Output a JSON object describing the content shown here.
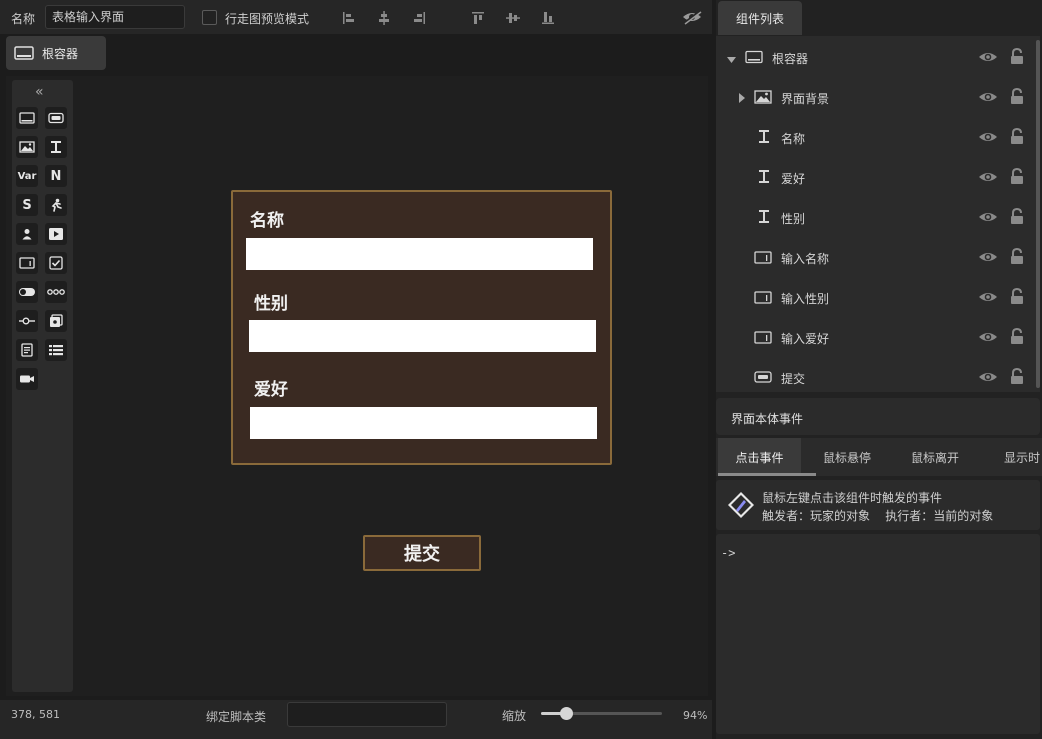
{
  "toolbar": {
    "name_label": "名称",
    "name_value": "表格输入界面",
    "preview_label": "行走图预览模式",
    "align_icons": [
      "align-left-icon",
      "align-center-h-icon",
      "align-right-icon",
      "align-top-icon",
      "align-center-v-icon",
      "align-bottom-icon"
    ],
    "preview_toggle_icon": "eye-slash-icon"
  },
  "root_tab": {
    "label": "根容器",
    "icon": "container-icon"
  },
  "palette": {
    "collapse_glyph": "«",
    "items": [
      {
        "name": "container-icon",
        "text": ""
      },
      {
        "name": "button-icon",
        "text": ""
      },
      {
        "name": "image-icon",
        "text": ""
      },
      {
        "name": "text-icon",
        "text": ""
      },
      {
        "name": "variable-icon",
        "text": "Var"
      },
      {
        "name": "number-icon",
        "text": "N"
      },
      {
        "name": "string-icon",
        "text": "S"
      },
      {
        "name": "actor-icon",
        "text": ""
      },
      {
        "name": "character-icon",
        "text": ""
      },
      {
        "name": "video-icon",
        "text": ""
      },
      {
        "name": "input-icon",
        "text": ""
      },
      {
        "name": "checkbox-icon",
        "text": ""
      },
      {
        "name": "switch-icon",
        "text": ""
      },
      {
        "name": "progress-icon",
        "text": ""
      },
      {
        "name": "slider-icon",
        "text": ""
      },
      {
        "name": "gallery-icon",
        "text": ""
      },
      {
        "name": "document-icon",
        "text": ""
      },
      {
        "name": "list-icon",
        "text": ""
      },
      {
        "name": "camera-icon",
        "text": ""
      }
    ]
  },
  "form": {
    "fields": [
      {
        "label": "名称",
        "value": ""
      },
      {
        "label": "性别",
        "value": ""
      },
      {
        "label": "爱好",
        "value": ""
      }
    ],
    "submit_label": "提交"
  },
  "statusbar": {
    "coords": "378, 581",
    "bind_label": "绑定脚本类",
    "bind_value": "",
    "zoom_label": "缩放",
    "zoom_value": "94%",
    "zoom_level": 0.94
  },
  "components": {
    "tab_label": "组件列表",
    "tree": [
      {
        "label": "根容器",
        "icon": "container-icon",
        "toggle": "caret-down-icon"
      },
      {
        "label": "界面背景",
        "icon": "image-icon",
        "toggle": "caret-right-icon"
      },
      {
        "label": "名称",
        "icon": "text-icon",
        "toggle": ""
      },
      {
        "label": "爱好",
        "icon": "text-icon",
        "toggle": ""
      },
      {
        "label": "性别",
        "icon": "text-icon",
        "toggle": ""
      },
      {
        "label": "输入名称",
        "icon": "input-icon",
        "toggle": ""
      },
      {
        "label": "输入性别",
        "icon": "input-icon",
        "toggle": ""
      },
      {
        "label": "输入爱好",
        "icon": "input-icon",
        "toggle": ""
      },
      {
        "label": "提交",
        "icon": "button-icon",
        "toggle": ""
      }
    ]
  },
  "events": {
    "title": "界面本体事件",
    "tabs": [
      "点击事件",
      "鼠标悬停",
      "鼠标离开",
      "显示时"
    ],
    "active_tab": "点击事件",
    "description_line1": "鼠标左键点击该组件时触发的事件",
    "description_line2": "触发者：玩家的对象    执行者：当前的对象",
    "body": "->"
  },
  "colors": {
    "panel_fill": "#3a2a22",
    "panel_border": "#8a6a3a",
    "accent_event_icon": "#8a8cf0"
  }
}
